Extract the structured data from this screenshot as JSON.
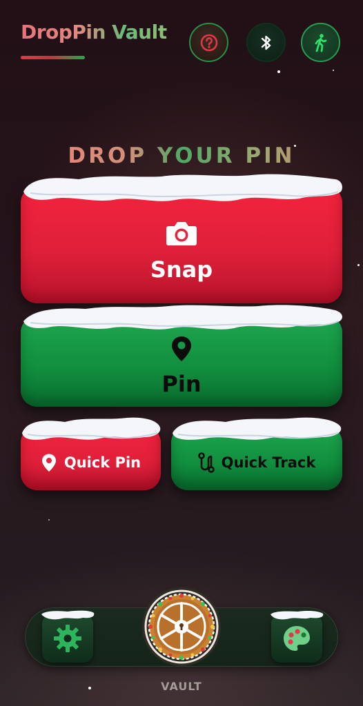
{
  "app": {
    "title": "DropPin Vault"
  },
  "header": {
    "buttons": [
      {
        "name": "help",
        "icon": "question-circle-icon"
      },
      {
        "name": "bluetooth",
        "icon": "bluetooth-icon"
      },
      {
        "name": "walk-mode",
        "icon": "walking-person-icon"
      }
    ]
  },
  "main": {
    "section_title": "DROP YOUR PIN",
    "snap": {
      "label": "Snap",
      "icon": "camera-icon"
    },
    "pin": {
      "label": "Pin",
      "icon": "map-pin-icon"
    },
    "quick_pin": {
      "label": "Quick Pin",
      "icon": "location-pin-icon"
    },
    "quick_track": {
      "label": "Quick Track",
      "icon": "route-icon"
    }
  },
  "bottom_nav": {
    "settings": {
      "icon": "gear-icon"
    },
    "vault": {
      "label": "VAULT",
      "icon": "vault-wheel-icon"
    },
    "palette": {
      "icon": "palette-icon"
    }
  },
  "colors": {
    "accent_red": "#e8223c",
    "accent_green": "#15984a",
    "background": "#221016",
    "snow": "#f4f6fa"
  }
}
